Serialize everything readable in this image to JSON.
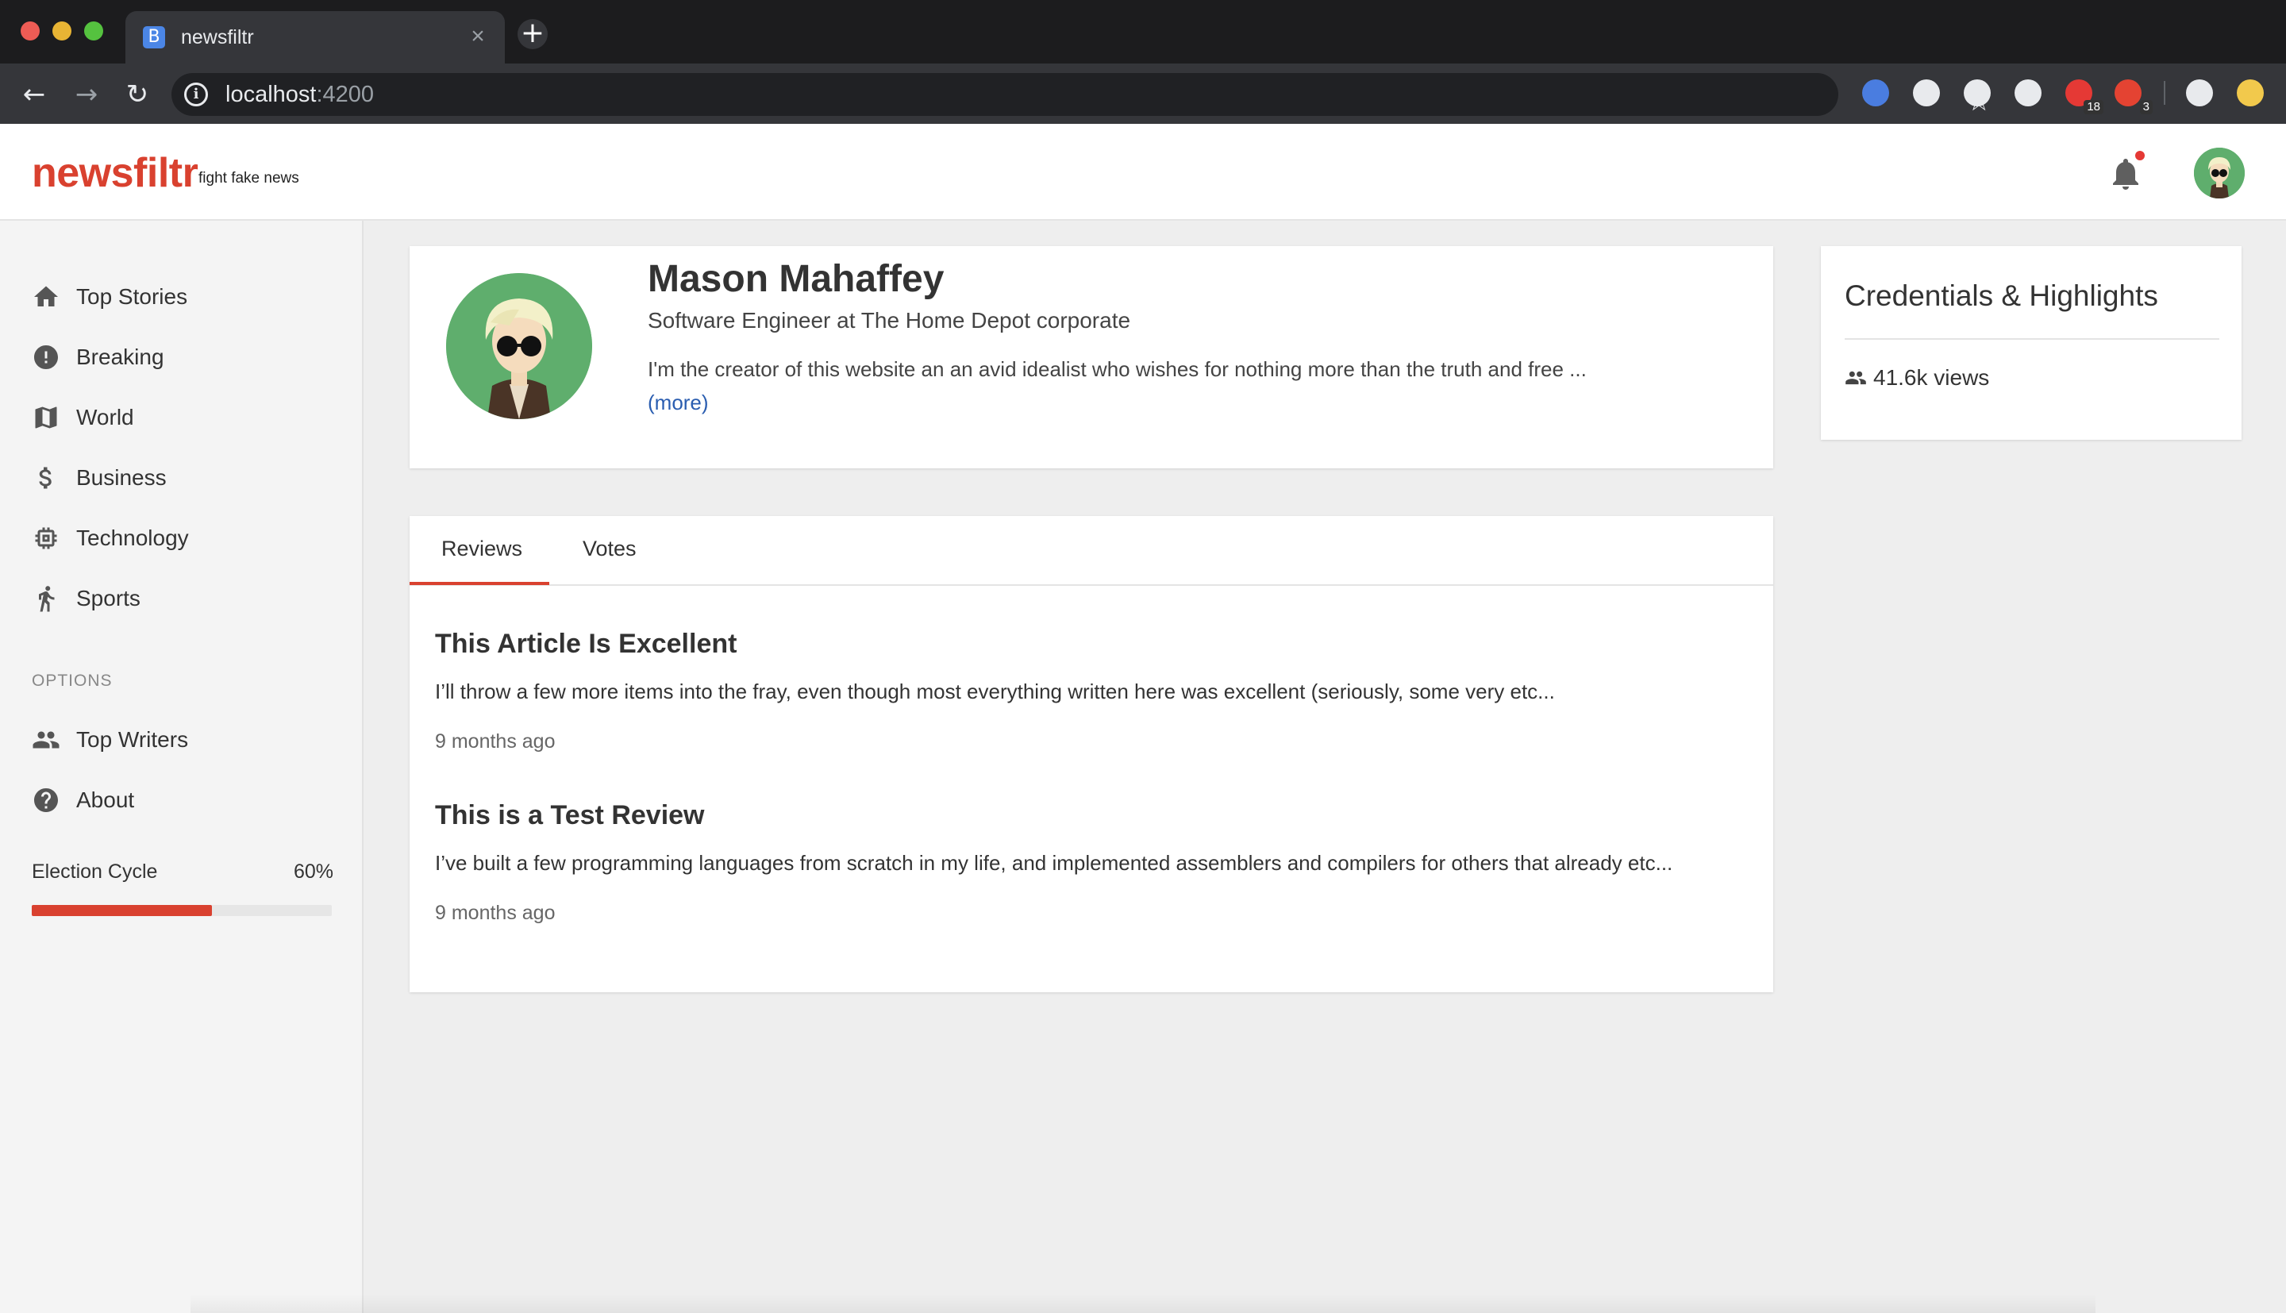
{
  "browser": {
    "tab_title": "newsfiltr",
    "tab_favicon_letter": "B",
    "url_host": "localhost",
    "url_port": ":4200",
    "extensions": [
      {
        "name": "ext-glasses-icon",
        "color": "#4a7de0"
      },
      {
        "name": "ext-globe-icon",
        "color": "#e8eaed"
      },
      {
        "name": "ext-camera-icon",
        "color": "#e8eaed"
      },
      {
        "name": "ext-keyhole-icon",
        "color": "#e8eaed"
      },
      {
        "name": "ext-shield-icon",
        "color": "#e53935",
        "badge": "18"
      },
      {
        "name": "ext-todoist-icon",
        "color": "#e44332",
        "badge": "3"
      },
      {
        "name": "ext-mountain-icon",
        "color": "#e8eaed"
      },
      {
        "name": "ext-profile-icon",
        "color": "#f2c94c"
      }
    ]
  },
  "header": {
    "logo": "newsfiltr",
    "tagline": "fight fake news",
    "accent_color": "#d9412f"
  },
  "sidebar": {
    "items": [
      {
        "label": "Top Stories",
        "icon": "home-icon"
      },
      {
        "label": "Breaking",
        "icon": "alert-icon"
      },
      {
        "label": "World",
        "icon": "map-icon"
      },
      {
        "label": "Business",
        "icon": "dollar-icon"
      },
      {
        "label": "Technology",
        "icon": "chip-icon"
      },
      {
        "label": "Sports",
        "icon": "walk-icon"
      }
    ],
    "options_heading": "OPTIONS",
    "options": [
      {
        "label": "Top Writers",
        "icon": "people-icon"
      },
      {
        "label": "About",
        "icon": "help-icon"
      }
    ],
    "election": {
      "label": "Election Cycle",
      "percent_text": "60%",
      "progress": 0.6
    }
  },
  "profile": {
    "name": "Mason Mahaffey",
    "title": "Software Engineer at The Home Depot corporate",
    "bio": "I'm the creator of this website an an avid idealist who wishes for nothing more than the truth and free ...",
    "more_link": "(more)"
  },
  "credentials": {
    "title": "Credentials & Highlights",
    "views": "41.6k views"
  },
  "tabs": [
    {
      "label": "Reviews",
      "active": true
    },
    {
      "label": "Votes",
      "active": false
    }
  ],
  "reviews": [
    {
      "title": "This Article Is Excellent",
      "body": "I’ll throw a few more items into the fray, even though most everything written here was excellent (seriously, some very etc...",
      "time": "9 months ago"
    },
    {
      "title": "This is a Test Review",
      "body": "I’ve built a few programming languages from scratch in my life, and implemented assemblers and compilers for others that already etc...",
      "time": "9 months ago"
    }
  ]
}
